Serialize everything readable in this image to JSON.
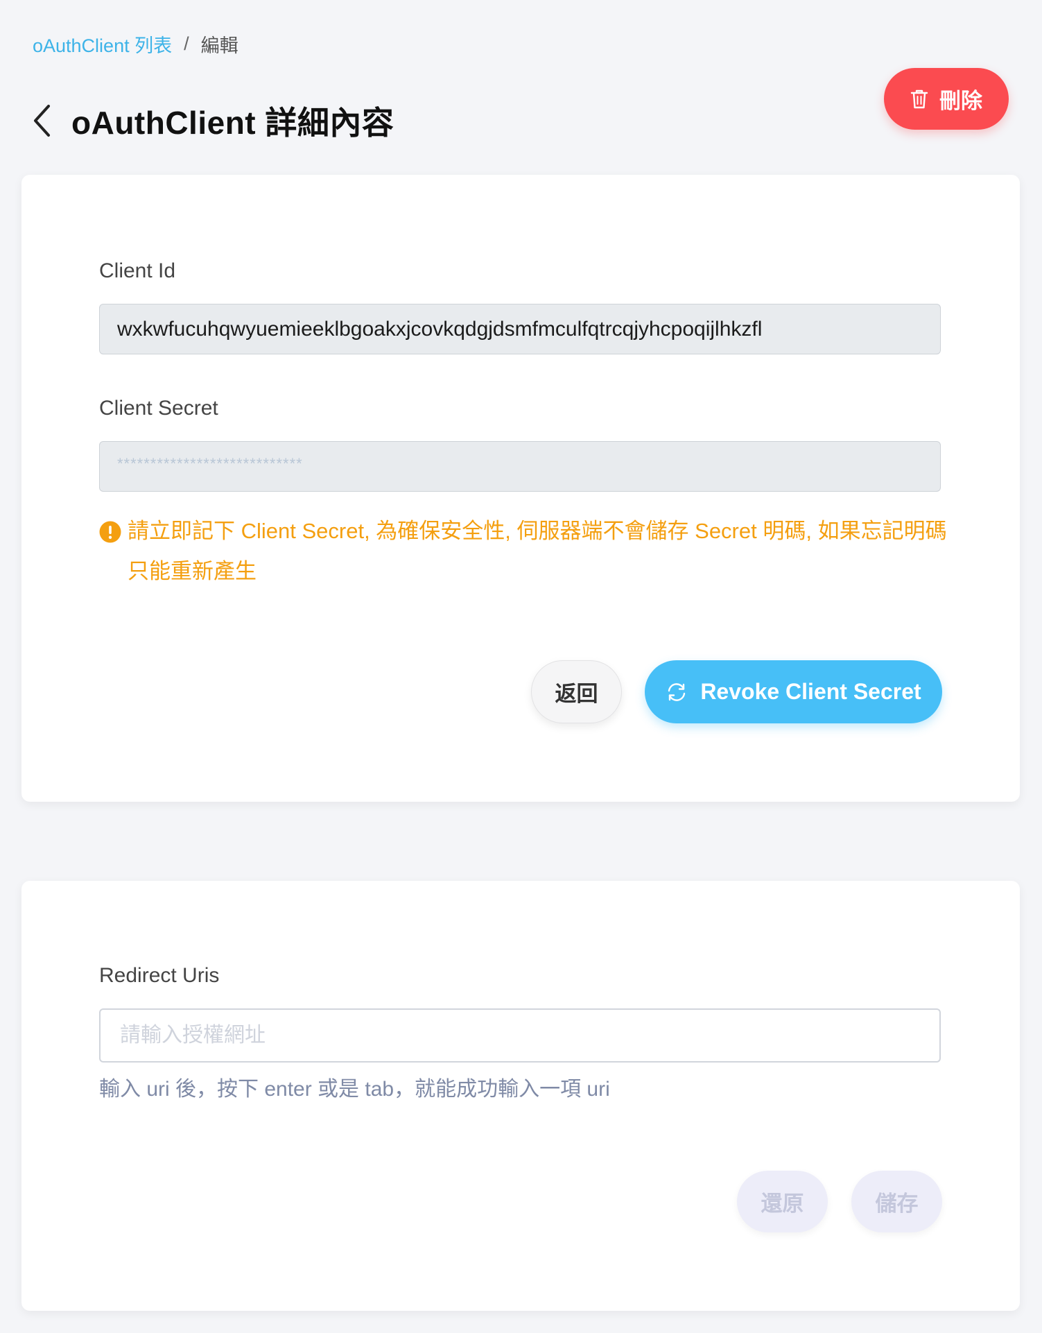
{
  "breadcrumb": {
    "list_link": "oAuthClient 列表",
    "separator": "/",
    "current": "編輯"
  },
  "header": {
    "title": "oAuthClient 詳細內容",
    "delete_label": "刪除"
  },
  "credentials": {
    "client_id_label": "Client Id",
    "client_id_value": "wxkwfucuhqwyuemieeklbgoakxjcovkqdgjdsmfmculfqtrcqjyhcpoqijlhkzfl",
    "client_secret_label": "Client Secret",
    "client_secret_value": "****************************",
    "warning": "請立即記下 Client Secret, 為確保安全性, 伺服器端不會儲存 Secret 明碼, 如果忘記明碼只能重新產生",
    "back_label": "返回",
    "revoke_label": "Revoke Client Secret"
  },
  "redirect": {
    "label": "Redirect Uris",
    "placeholder": "請輸入授權網址",
    "hint": "輸入 uri 後，按下 enter 或是 tab，就能成功輸入一項 uri",
    "reset_label": "還原",
    "save_label": "儲存"
  },
  "colors": {
    "accent": "#47bff7",
    "danger": "#fb4b50",
    "warning": "#f49f10",
    "link": "#3db3e8"
  },
  "icons": {
    "back": "chevron-left-icon",
    "delete": "trash-icon",
    "warning": "exclamation-circle-icon",
    "revoke": "refresh-icon"
  }
}
